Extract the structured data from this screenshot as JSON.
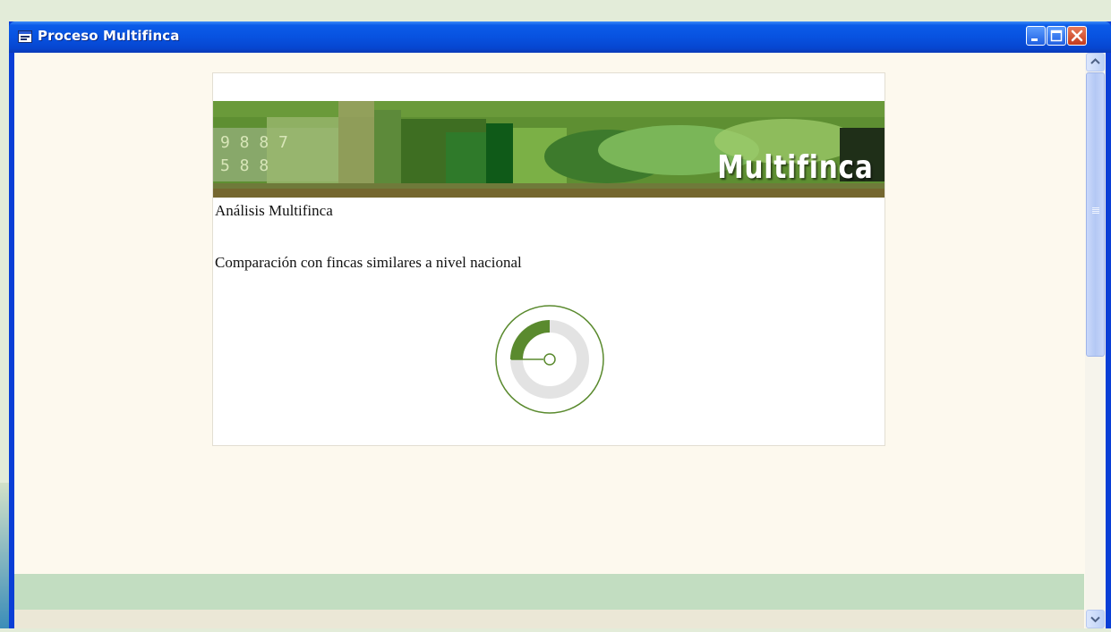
{
  "window": {
    "title": "Proceso Multifinca",
    "icon": "app-window-icon",
    "controls": [
      "minimize-icon",
      "maximize-icon",
      "close-icon"
    ]
  },
  "banner": {
    "title": "Multifinca"
  },
  "panel": {
    "heading": "Análisis Multifinca",
    "subheading": "Comparación con fincas similares a nivel nacional"
  },
  "loading": {
    "icon": "loading-spinner-icon",
    "accent": "#5a8a2e"
  },
  "colors": {
    "background": "#fdf9ee",
    "status_bar": "#c2ddc1",
    "titlebar": "#0852e0",
    "banner_green": "#6a9a3a"
  }
}
